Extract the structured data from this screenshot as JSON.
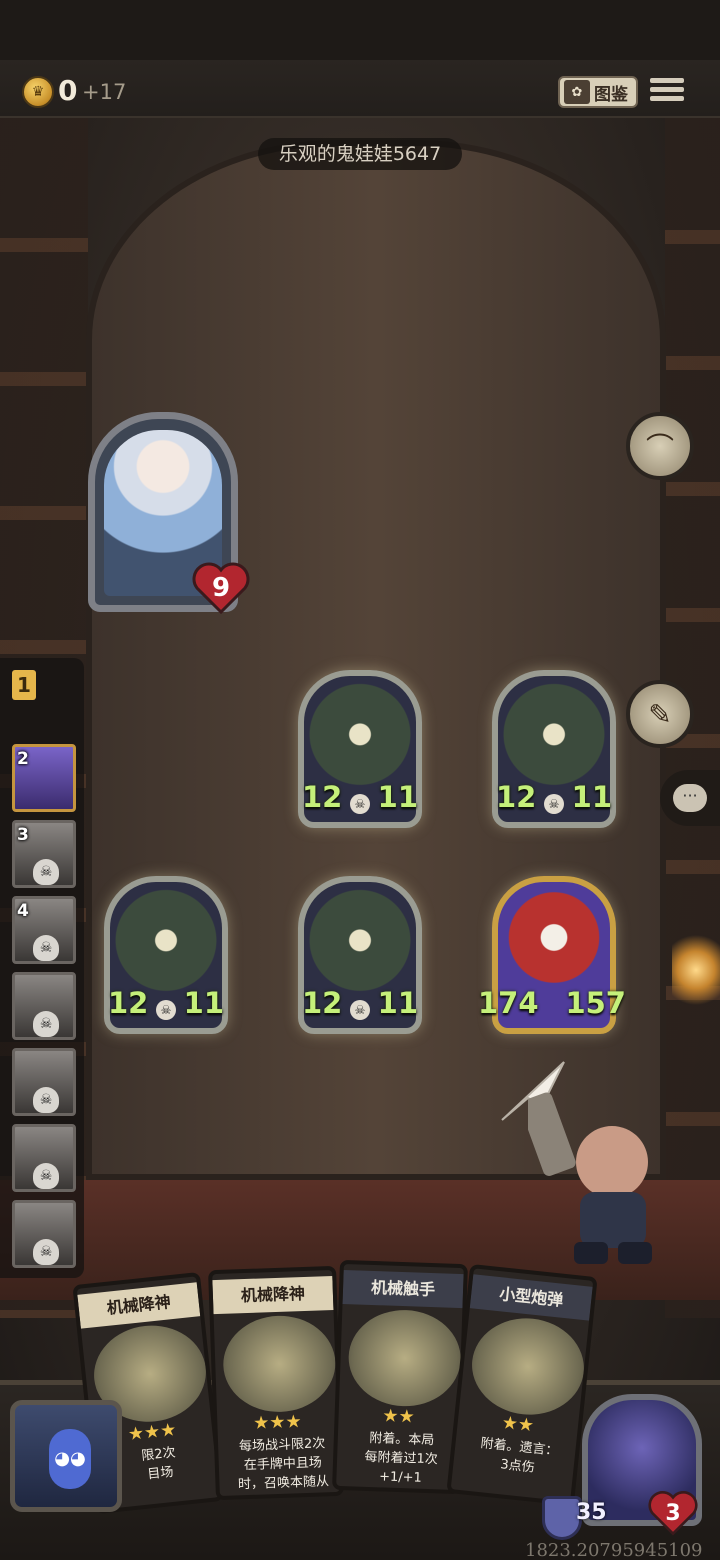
{
  "topbar": {
    "coin_icon": "gold-coin-icon",
    "coins": "0",
    "coin_income": "+17",
    "codex_label": "图鉴",
    "menu_icon": "hamburger-menu-icon"
  },
  "opponent": {
    "name": "乐观的鬼娃娃5647",
    "hero_health": "9"
  },
  "round": {
    "current": "1"
  },
  "players": [
    {
      "rank": "2",
      "active": true
    },
    {
      "rank": "3",
      "active": false
    },
    {
      "rank": "4",
      "active": false
    },
    {
      "rank": "",
      "active": false
    },
    {
      "rank": "",
      "active": false
    },
    {
      "rank": "",
      "active": false
    },
    {
      "rank": "",
      "active": false
    }
  ],
  "minions": [
    {
      "attack": "12",
      "health": "11",
      "kind": "demon"
    },
    {
      "attack": "12",
      "health": "11",
      "kind": "demon"
    },
    {
      "attack": "12",
      "health": "11",
      "kind": "demon"
    },
    {
      "attack": "12",
      "health": "11",
      "kind": "demon"
    },
    {
      "attack": "174",
      "health": "157",
      "kind": "clown"
    }
  ],
  "side_buttons": {
    "fan_icon": "folding-fan-icon",
    "scroll_icon": "map-scroll-icon",
    "chat_icon": "chat-bubble-icon"
  },
  "hand": [
    {
      "title": "机械降神",
      "desc": "限2次\n目场"
    },
    {
      "title": "机械降神",
      "desc": "每场战斗限2次\n在手牌中且场\n时，召唤本随从"
    },
    {
      "title": "机械触手",
      "desc": "附着。本局\n每附着过1次\n+1/+1"
    },
    {
      "title": "小型炮弹",
      "desc": "附着。遗言：\n3点伤"
    }
  ],
  "player": {
    "armor": "35",
    "health": "3"
  },
  "debug_text": "1823.20795945109",
  "colors": {
    "stat_green": "#c5f07a",
    "heart_red": "#b2262f",
    "gold": "#e5b64b"
  }
}
